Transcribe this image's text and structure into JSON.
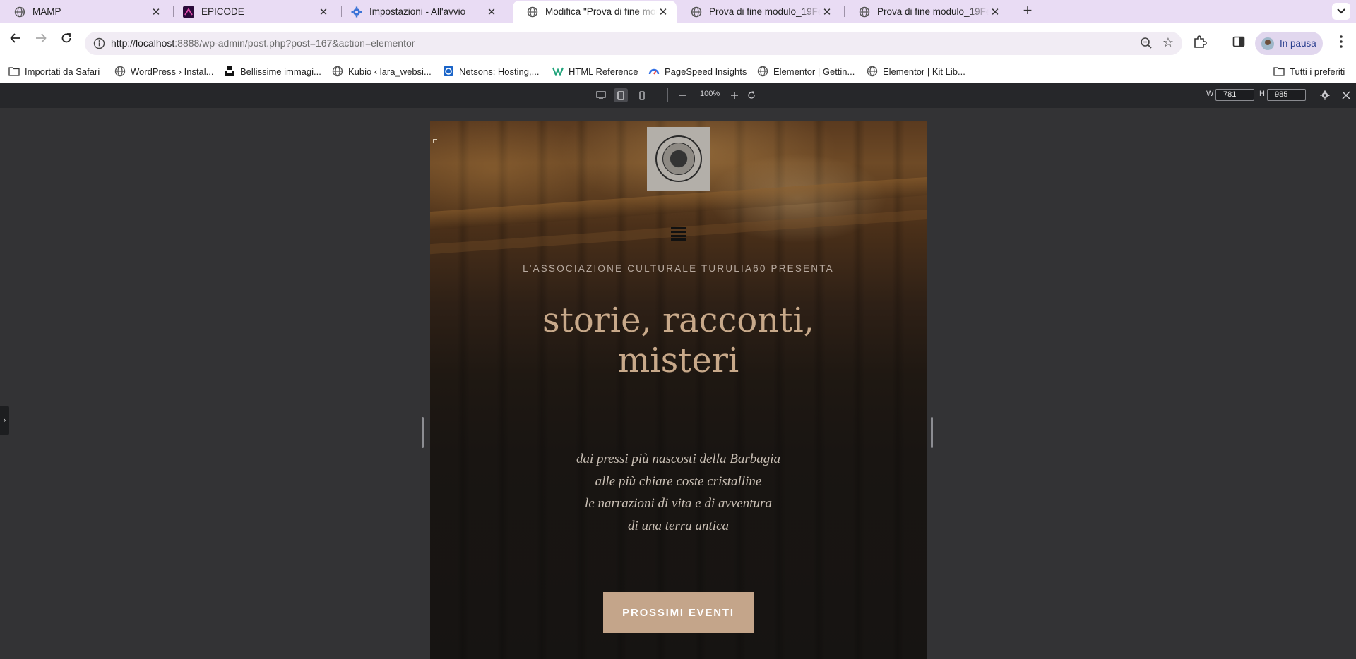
{
  "browser": {
    "tabs": [
      {
        "title": "MAMP",
        "icon": "globe-icon",
        "active": false
      },
      {
        "title": "EPICODE",
        "icon": "epicode-icon",
        "active": false
      },
      {
        "title": "Impostazioni - All'avvio",
        "icon": "gear-icon",
        "active": false
      },
      {
        "title": "Modifica \"Prova di fine modulo",
        "icon": "globe-icon",
        "active": true
      },
      {
        "title": "Prova di fine modulo_19Febbraio",
        "icon": "globe-icon",
        "active": false
      },
      {
        "title": "Prova di fine modulo_19Febbraio",
        "icon": "globe-icon",
        "active": false
      }
    ],
    "url_host": "http://localhost",
    "url_rest": ":8888/wp-admin/post.php?post=167&action=elementor",
    "profile_label": "In pausa",
    "bookmarks": [
      {
        "label": "Importati da Safari",
        "icon": "folder-icon"
      },
      {
        "label": "WordPress › Instal...",
        "icon": "globe-icon"
      },
      {
        "label": "Bellissime immagi...",
        "icon": "unsplash-icon"
      },
      {
        "label": "Kubio ‹ lara_websi...",
        "icon": "globe-icon"
      },
      {
        "label": "Netsons: Hosting,...",
        "icon": "netsons-icon"
      },
      {
        "label": "HTML Reference",
        "icon": "html-reference-icon"
      },
      {
        "label": "PageSpeed Insights",
        "icon": "pagespeed-icon"
      },
      {
        "label": "Elementor | Gettin...",
        "icon": "globe-icon"
      },
      {
        "label": "Elementor | Kit Lib...",
        "icon": "globe-icon"
      }
    ],
    "all_bookmarks_label": "Tutti i preferiti"
  },
  "responsive_bar": {
    "zoom": "100%",
    "width_label": "W",
    "width_value": "781",
    "height_label": "H",
    "height_value": "985",
    "active_device": "tablet"
  },
  "page": {
    "presents": "L'ASSOCIAZIONE CULTURALE TURULIA60 PRESENTA",
    "headline_line1": "storie, racconti,",
    "headline_line2": "misteri",
    "poem": [
      "dai pressi più nascosti della Barbagia",
      "alle più chiare coste cristalline",
      "le narrazioni di vita e di avventura",
      "di una terra antica"
    ],
    "cta_label": "PROSSIMI EVENTI",
    "accent_color": "#c4a58a"
  }
}
